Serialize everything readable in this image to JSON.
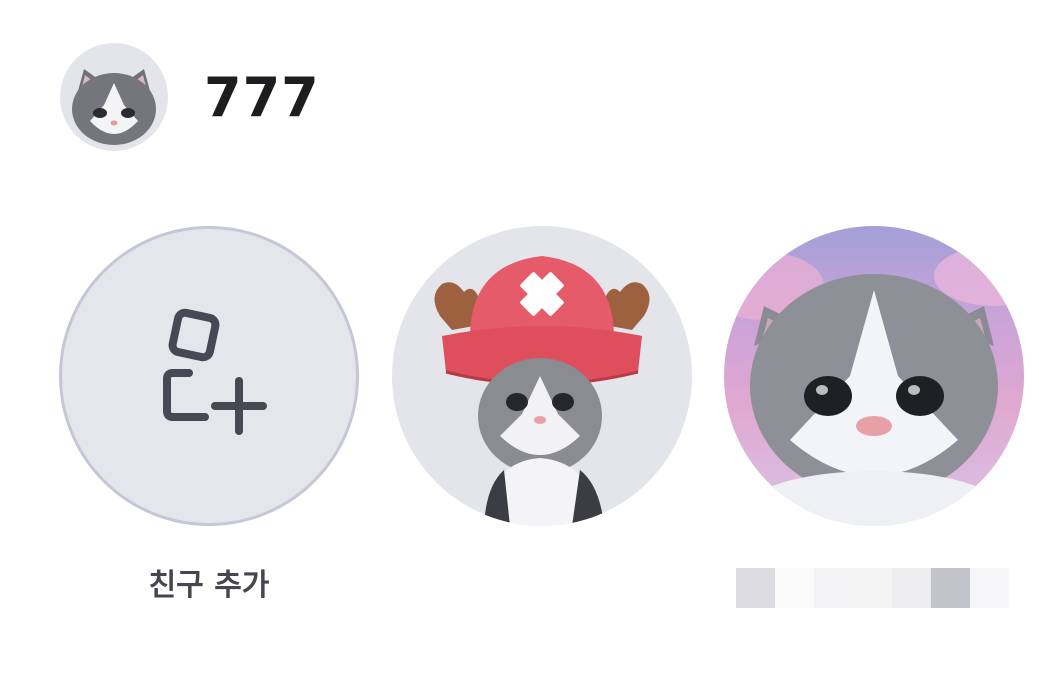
{
  "profile": {
    "name": "777",
    "avatar_icon": "kitten-avatar-icon"
  },
  "friends": {
    "add_label": "친구 추가",
    "add_icon": "add-friend-icon",
    "items": [
      {
        "avatar_icon": "kitten-chopper-hat-avatar",
        "label": ""
      },
      {
        "avatar_icon": "kitten-pink-background-avatar",
        "label": ""
      }
    ]
  },
  "colors": {
    "circle_bg": "#e4e5ea",
    "add_border": "#c6c7d6",
    "icon_stroke": "#474853",
    "text_dark": "#1d1d1f",
    "hat_red": "#e65b69",
    "antler_brown": "#9e6140"
  },
  "blurred_name_tiles": [
    "#dcdce1",
    "#fafafb",
    "#f3f3f6",
    "#f3f3f3",
    "#ededf0",
    "#c3c4ca",
    "#f6f6f8"
  ]
}
